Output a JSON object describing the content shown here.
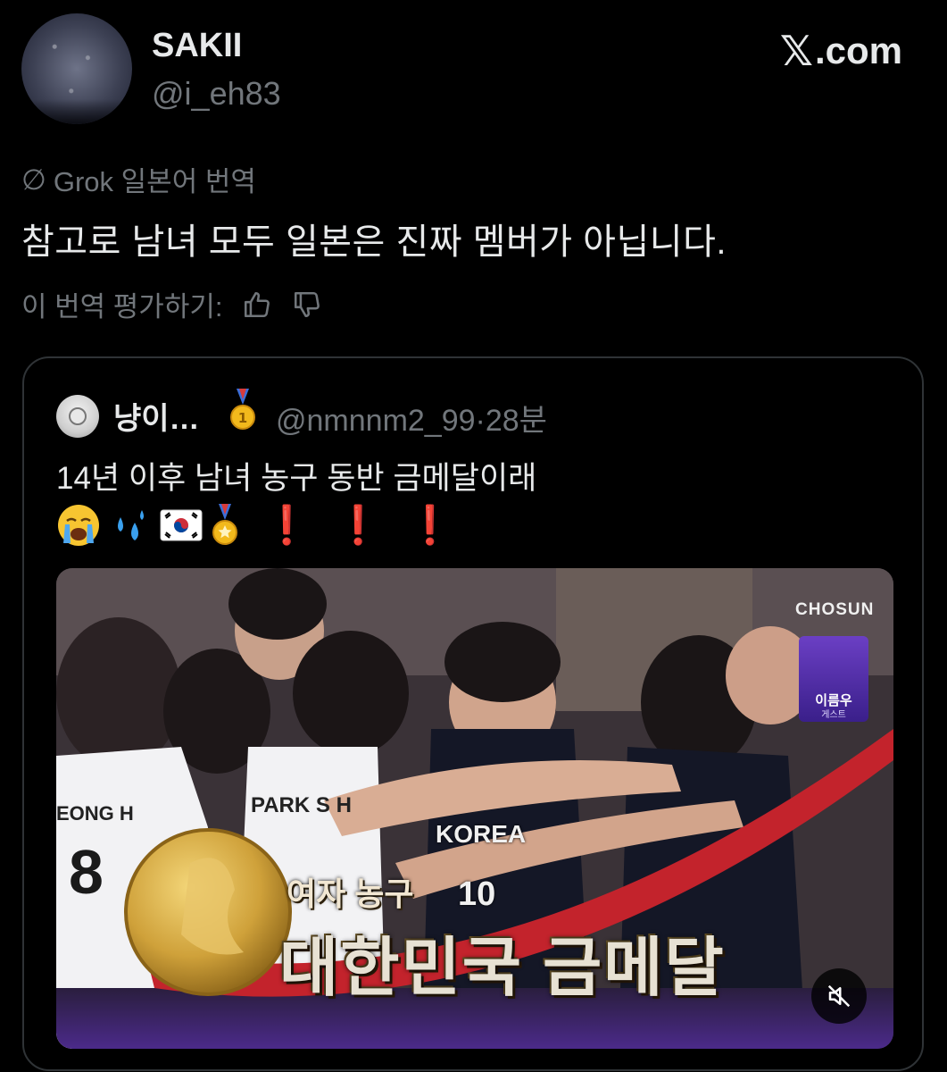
{
  "header": {
    "author_name": "SAKII",
    "author_handle": "@i_eh83",
    "brand_mark": "𝕏",
    "brand_suffix": ".com"
  },
  "translation": {
    "badge": "Grok 일본어 번역",
    "text": "참고로 남녀 모두 일본은 진짜 멤버가 아닙니다.",
    "rate_label": "이 번역 평가하기:"
  },
  "quote": {
    "name": "냥이…",
    "handle": "@nmnnm2_99·28분",
    "text": "14년 이후 남녀 농구 동반 금메달이래",
    "emoji_exclaim": "❗"
  },
  "media": {
    "caption_small": "여자 농구",
    "caption_big": "대한민국 금메달",
    "jersey_1": "EONG H",
    "jersey_1_num": "8",
    "jersey_2": "PARK S H",
    "jersey_3": "KOREA",
    "jersey_3_num": "10",
    "channel": "CHOSUN",
    "cast_name": "이름우",
    "cast_role": "게스트"
  },
  "colors": {
    "background": "#000000",
    "text_primary": "#e7e9ea",
    "text_secondary": "#71767b",
    "border": "#2f3336",
    "exclaim_red": "#e0242b",
    "gold": "#d4a63a"
  },
  "icons": {
    "slash": "empty-set-icon",
    "thumbs_up": "thumbs-up-icon",
    "thumbs_down": "thumbs-down-icon",
    "medal": "gold-medal-icon",
    "mute": "speaker-muted-icon"
  }
}
